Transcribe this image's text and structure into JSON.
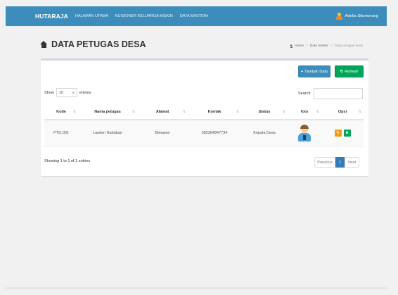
{
  "navbar": {
    "brand": "HUTARAJA",
    "links": [
      "HALAMAN UTAMA",
      "KUISIONER KELUARGA MISKIN",
      "DATA MASTER"
    ],
    "dropdown_caret": "▾",
    "user_name": "Adelia Situmorang",
    "user_icon": "user-icon",
    "color": "#3c8dbc"
  },
  "page": {
    "title": "DATA PETUGAS DESA",
    "title_icon": "home-icon"
  },
  "breadcrumb": {
    "home": "Home",
    "parent": "Data master",
    "current": "Data petugas desa",
    "separator": ">"
  },
  "actions": {
    "add_label": "Tambah Data",
    "add_icon": "+",
    "refresh_label": "Refresh",
    "refresh_icon": "↻"
  },
  "table_controls": {
    "show_label": "Show",
    "page_size": "10",
    "entries_label": "entries",
    "search_label": "Search"
  },
  "table": {
    "columns": [
      "Kode",
      "Nama petugas",
      "Alamat",
      "Kontak",
      "Status",
      "foto",
      "Opsi"
    ],
    "rows": [
      {
        "kode": "PTG.001",
        "nama": "Lasdon Nababan",
        "alamat": "Belawan",
        "kontak": "082284847734",
        "status": "Kepala Desa",
        "edit_icon": "✎",
        "delete_icon": "✖"
      }
    ]
  },
  "footer": {
    "info": "Showing 1 to 1 of 1 entries",
    "prev": "Previous",
    "page": "1",
    "next": "Next"
  }
}
